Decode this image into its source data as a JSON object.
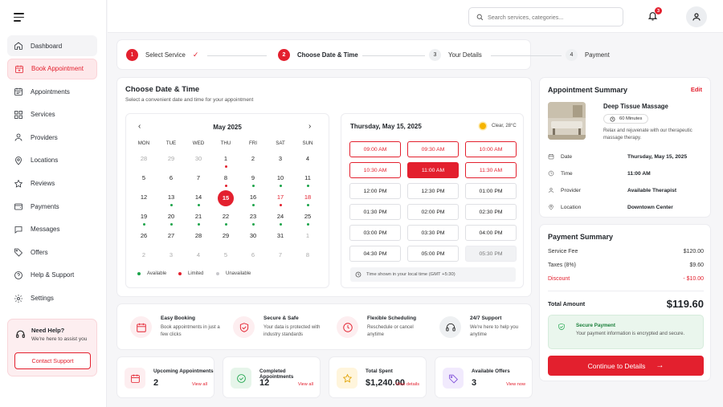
{
  "sidebar": {
    "items": [
      {
        "label": "Dashboard",
        "icon": "home-icon"
      },
      {
        "label": "Book Appointment",
        "icon": "calendar-plus-icon"
      },
      {
        "label": "Appointments",
        "icon": "calendar-list-icon"
      },
      {
        "label": "Services",
        "icon": "grid-icon"
      },
      {
        "label": "Providers",
        "icon": "user-icon"
      },
      {
        "label": "Locations",
        "icon": "map-pin-icon"
      },
      {
        "label": "Reviews",
        "icon": "star-icon"
      },
      {
        "label": "Payments",
        "icon": "wallet-icon"
      },
      {
        "label": "Messages",
        "icon": "message-icon"
      },
      {
        "label": "Offers",
        "icon": "tag-icon"
      },
      {
        "label": "Help & Support",
        "icon": "help-icon"
      },
      {
        "label": "Settings",
        "icon": "gear-icon"
      }
    ],
    "help": {
      "title": "Need Help?",
      "subtitle": "We're here to assist you",
      "button": "Contact Support"
    }
  },
  "topbar": {
    "search_placeholder": "Search services, categories...",
    "notifications": "3"
  },
  "stepper": {
    "steps": [
      {
        "num": "1",
        "label": "Select Service"
      },
      {
        "num": "2",
        "label": "Choose Date & Time"
      },
      {
        "num": "3",
        "label": "Your Details"
      },
      {
        "num": "4",
        "label": "Payment"
      }
    ]
  },
  "datetime": {
    "title": "Choose Date & Time",
    "subtitle": "Select a convenient date and time for your appointment",
    "calendar": {
      "month": "May 2025",
      "weekdays": [
        "MON",
        "TUE",
        "WED",
        "THU",
        "FRI",
        "SAT",
        "SUN"
      ],
      "weeks": [
        [
          {
            "d": "28",
            "m": 1
          },
          {
            "d": "29",
            "m": 1
          },
          {
            "d": "30",
            "m": 1
          },
          {
            "d": "1",
            "dot": "r"
          },
          {
            "d": "2"
          },
          {
            "d": "3"
          },
          {
            "d": "4"
          }
        ],
        [
          {
            "d": "5"
          },
          {
            "d": "6"
          },
          {
            "d": "7"
          },
          {
            "d": "8",
            "dot": "r"
          },
          {
            "d": "9",
            "dot": "g"
          },
          {
            "d": "10",
            "dot": "g"
          },
          {
            "d": "11",
            "dot": "g"
          }
        ],
        [
          {
            "d": "12"
          },
          {
            "d": "13",
            "dot": "g"
          },
          {
            "d": "14",
            "dot": "g"
          },
          {
            "d": "15",
            "sel": 1
          },
          {
            "d": "16",
            "dot": "g"
          },
          {
            "d": "17",
            "dot": "r",
            "red": 1
          },
          {
            "d": "18",
            "dot": "g",
            "red": 1
          }
        ],
        [
          {
            "d": "19",
            "dot": "g"
          },
          {
            "d": "20",
            "dot": "g"
          },
          {
            "d": "21",
            "dot": "g"
          },
          {
            "d": "22",
            "dot": "g"
          },
          {
            "d": "23",
            "dot": "g"
          },
          {
            "d": "24",
            "dot": "g"
          },
          {
            "d": "25",
            "dot": "g"
          }
        ],
        [
          {
            "d": "26"
          },
          {
            "d": "27"
          },
          {
            "d": "28"
          },
          {
            "d": "29"
          },
          {
            "d": "30"
          },
          {
            "d": "31"
          },
          {
            "d": "1",
            "m": 1
          }
        ],
        [
          {
            "d": "2",
            "m": 1
          },
          {
            "d": "3",
            "m": 1
          },
          {
            "d": "4",
            "m": 1
          },
          {
            "d": "5",
            "m": 1
          },
          {
            "d": "6",
            "m": 1
          },
          {
            "d": "7",
            "m": 1
          },
          {
            "d": "8",
            "m": 1
          }
        ]
      ],
      "legend": [
        "Available",
        "Limited",
        "Unavailable"
      ],
      "colors": {
        "available": "#1ba44a",
        "limited": "#e3202e",
        "unavailable": "#c8c8cc"
      }
    },
    "times": {
      "date_label": "Thursday, May 15, 2025",
      "weather": "Clear, 28°C",
      "slots": [
        {
          "t": "09:00 AM",
          "s": "lim"
        },
        {
          "t": "09:30 AM",
          "s": "lim"
        },
        {
          "t": "10:00 AM",
          "s": "lim"
        },
        {
          "t": "10:30 AM",
          "s": "lim"
        },
        {
          "t": "11:00 AM",
          "s": "sel"
        },
        {
          "t": "11:30 AM",
          "s": "lim"
        },
        {
          "t": "12:00 PM",
          "s": ""
        },
        {
          "t": "12:30 PM",
          "s": ""
        },
        {
          "t": "01:00 PM",
          "s": ""
        },
        {
          "t": "01:30 PM",
          "s": ""
        },
        {
          "t": "02:00 PM",
          "s": ""
        },
        {
          "t": "02:30 PM",
          "s": ""
        },
        {
          "t": "03:00 PM",
          "s": ""
        },
        {
          "t": "03:30 PM",
          "s": ""
        },
        {
          "t": "04:00 PM",
          "s": ""
        },
        {
          "t": "04:30 PM",
          "s": ""
        },
        {
          "t": "05:00 PM",
          "s": ""
        },
        {
          "t": "05:30 PM",
          "s": "dis"
        }
      ],
      "note": "Time shown in your local time (GMT +5:30)"
    }
  },
  "features": [
    {
      "title": "Easy Booking",
      "desc": "Book appointments in just a few clicks",
      "icon": "calendar-icon"
    },
    {
      "title": "Secure & Safe",
      "desc": "Your data is protected with industry standards",
      "icon": "shield-check-icon"
    },
    {
      "title": "Flexible Scheduling",
      "desc": "Reschedule or cancel anytime",
      "icon": "clock-icon"
    },
    {
      "title": "24/7 Support",
      "desc": "We're here to help you anytime",
      "icon": "headset-icon"
    }
  ],
  "stats": [
    {
      "label": "Upcoming Appointments",
      "value": "2",
      "action": "View all",
      "icon": "calendar-icon"
    },
    {
      "label": "Completed Appointments",
      "value": "12",
      "action": "View all",
      "icon": "check-circle-icon"
    },
    {
      "label": "Total Spent",
      "value": "$1,240.00",
      "action": "View details",
      "icon": "star-icon"
    },
    {
      "label": "Available Offers",
      "value": "3",
      "action": "View now",
      "icon": "tag-icon"
    }
  ],
  "summary": {
    "title": "Appointment Summary",
    "edit": "Edit",
    "service": {
      "name": "Deep Tissue Massage",
      "duration": "60 Minutes",
      "desc": "Relax and rejuvenate with our therapeutic massage therapy."
    },
    "rows": [
      {
        "label": "Date",
        "value": "Thursday, May 15, 2025",
        "icon": "calendar-icon"
      },
      {
        "label": "Time",
        "value": "11:00 AM",
        "icon": "clock-icon"
      },
      {
        "label": "Provider",
        "value": "Available Therapist",
        "icon": "user-icon"
      },
      {
        "label": "Location",
        "value": "Downtown Center",
        "icon": "map-pin-icon"
      }
    ]
  },
  "payment": {
    "title": "Payment Summary",
    "rows": [
      {
        "label": "Service Fee",
        "value": "$120.00"
      },
      {
        "label": "Taxes (8%)",
        "value": "$9.60"
      },
      {
        "label": "Discount",
        "value": "- $10.00"
      }
    ],
    "total_label": "Total Amount",
    "total_value": "$119.60",
    "secure_title": "Secure Payment",
    "secure_desc": "Your payment information is encrypted and secure.",
    "cta": "Continue to Details"
  },
  "colors": {
    "accent": "#e3202e",
    "success": "#1ba44a"
  }
}
